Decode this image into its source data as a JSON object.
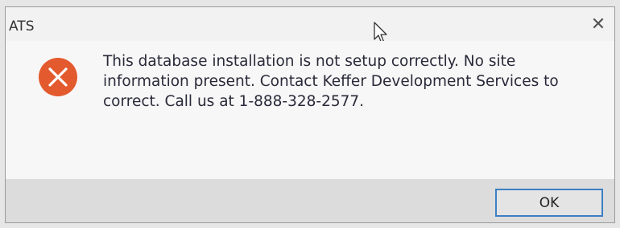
{
  "window": {
    "title": "ATS",
    "close_glyph": "✕"
  },
  "dialog": {
    "icon": "error-icon",
    "icon_color": "#e35a2e",
    "message": "This database installation is not setup correctly. No site information present. Contact Keffer Development Services to correct. Call us at 1-888-328-2577."
  },
  "buttons": {
    "ok_label": "OK"
  },
  "colors": {
    "accent": "#3c7fc4",
    "dialog_bg": "#f2f2f2",
    "footer_bg": "#dcdcdc"
  }
}
